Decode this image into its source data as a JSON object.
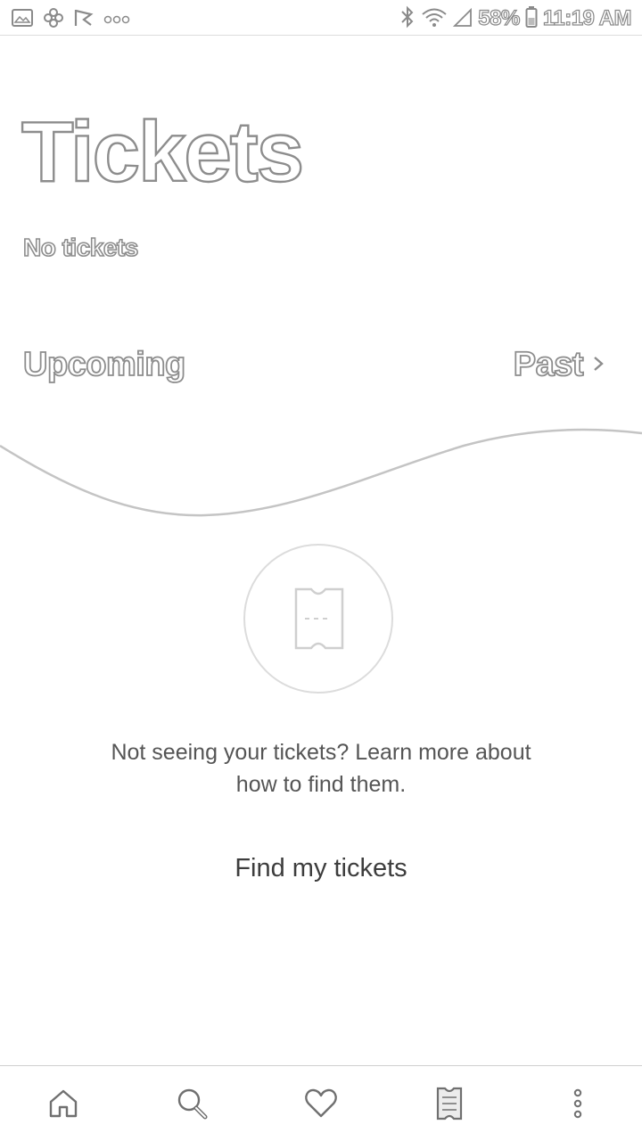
{
  "status_bar": {
    "battery": "58%",
    "time": "11:19 AM",
    "left_icons": [
      "gallery-icon",
      "pinwheel-icon",
      "check-flag-icon",
      "more-dots-icon"
    ],
    "right_icons": [
      "bluetooth-icon",
      "wifi-icon",
      "signal-icon",
      "battery-icon"
    ]
  },
  "header": {
    "title": "Tickets",
    "subtitle": "No tickets"
  },
  "tabs": {
    "upcoming": "Upcoming",
    "past": "Past"
  },
  "empty_state": {
    "icon": "ticket-icon",
    "message": "Not seeing your tickets? Learn more about how to find them.",
    "action": "Find my tickets"
  },
  "bottom_nav": {
    "items": [
      {
        "icon": "home-icon"
      },
      {
        "icon": "search-icon"
      },
      {
        "icon": "heart-icon"
      },
      {
        "icon": "ticket-icon"
      },
      {
        "icon": "more-vertical-icon"
      }
    ]
  },
  "colors": {
    "outline_text": "#8d8d8d",
    "body_text": "#555555",
    "divider": "#cfcfcf"
  }
}
